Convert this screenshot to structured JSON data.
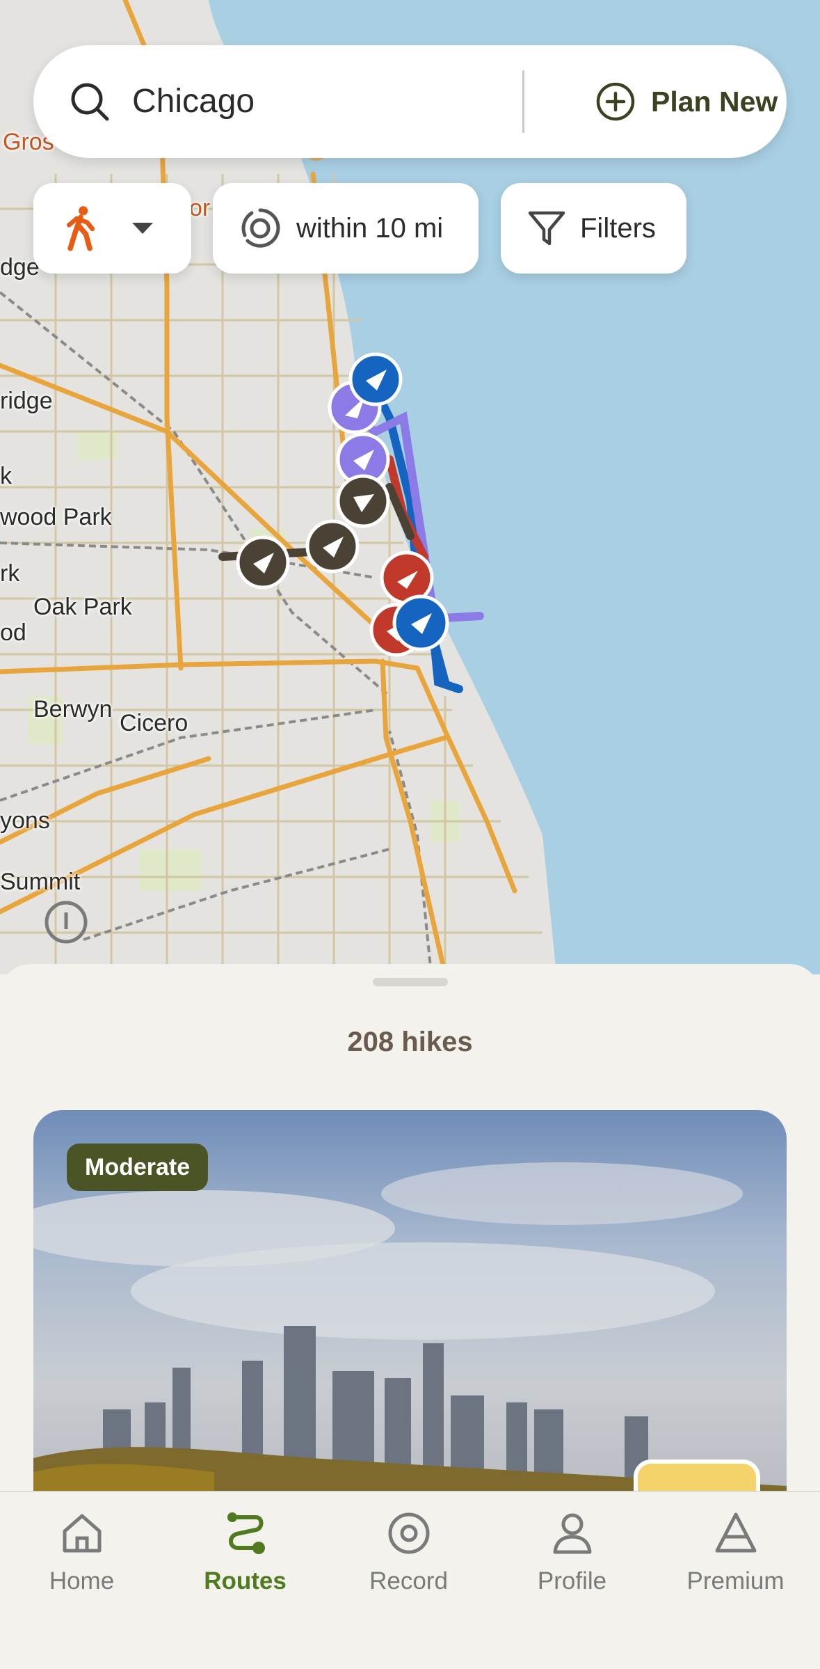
{
  "search": {
    "query": "Chicago",
    "plan_new_label": "Plan New"
  },
  "filters": {
    "activity_icon": "walking-person-icon",
    "radius_label": "within 10 mi",
    "filters_label": "Filters"
  },
  "map": {
    "labels": [
      "Gros",
      "or",
      "dge",
      "ridge",
      "k",
      "wood Park",
      "rk",
      "Oak Park",
      "od",
      "Berwyn",
      "Cicero",
      "yons",
      "Summit"
    ]
  },
  "results": {
    "count_label": "208 hikes"
  },
  "card": {
    "difficulty": "Moderate"
  },
  "nav": {
    "items": [
      {
        "label": "Home",
        "icon": "home-icon",
        "active": false
      },
      {
        "label": "Routes",
        "icon": "routes-icon",
        "active": true
      },
      {
        "label": "Record",
        "icon": "record-icon",
        "active": false
      },
      {
        "label": "Profile",
        "icon": "profile-icon",
        "active": false
      },
      {
        "label": "Premium",
        "icon": "premium-icon",
        "active": false
      }
    ]
  },
  "colors": {
    "accent": "#4f7a1e",
    "badge": "#4a5425",
    "marker_blue": "#1565c0",
    "marker_purple": "#8c7ae6",
    "marker_red": "#c0392b",
    "marker_dark": "#4a4235",
    "water": "#a9cfe3",
    "land": "#e4e3df"
  }
}
